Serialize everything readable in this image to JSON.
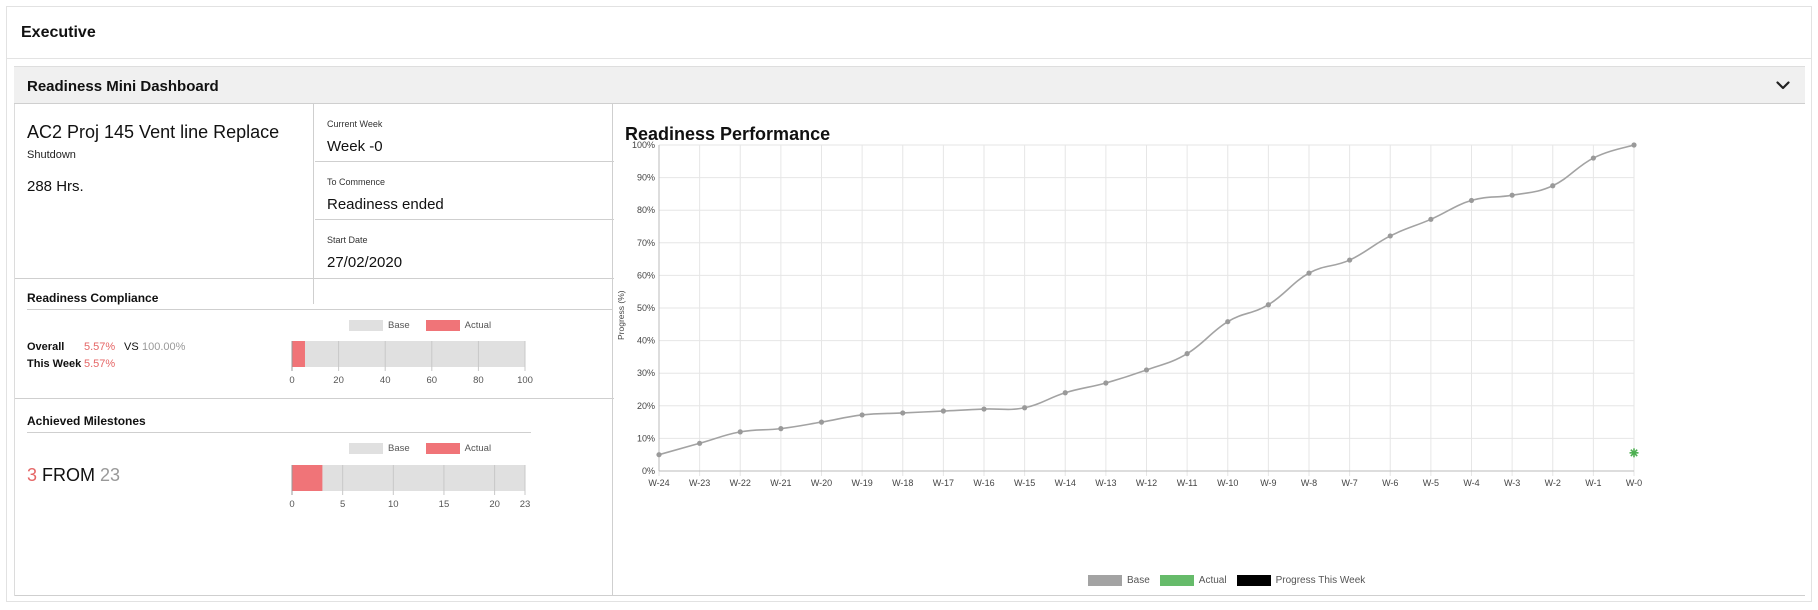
{
  "page": {
    "section_title": "Executive",
    "panel_title": "Readiness Mini Dashboard",
    "collapse_icon": "chevron-down-icon"
  },
  "project": {
    "name": "AC2 Proj 145 Vent line Replace",
    "type": "Shutdown",
    "hours": "288 Hrs."
  },
  "info": {
    "current_week_label": "Current Week",
    "current_week_value": "Week -0",
    "to_commence_label": "To Commence",
    "to_commence_value": "Readiness ended",
    "start_date_label": "Start Date",
    "start_date_value": "27/02/2020"
  },
  "compliance": {
    "title": "Readiness Compliance",
    "legend_base": "Base",
    "legend_actual": "Actual",
    "overall_label": "Overall",
    "overall_actual": "5.57%",
    "vs": "VS",
    "overall_base": "100.00%",
    "this_week_label": "This Week",
    "this_week_value": "5.57%",
    "bar": {
      "base": 100,
      "actual": 5.57,
      "max": 100,
      "ticks": [
        0,
        20,
        40,
        60,
        80,
        100
      ]
    }
  },
  "milestones": {
    "title": "Achieved Milestones",
    "legend_base": "Base",
    "legend_actual": "Actual",
    "achieved": "3",
    "from": "FROM",
    "total": "23",
    "bar": {
      "base": 23,
      "actual": 3,
      "max": 23,
      "ticks": [
        0,
        5,
        10,
        15,
        20,
        23
      ]
    }
  },
  "colors": {
    "base_bar": "#e0e0e0",
    "actual_bar": "#f07478",
    "line": "#a3a3a3",
    "actual_marker": "#4caf50",
    "progress_this_week": "#000000",
    "legend_base": "#a3a3a3",
    "legend_actual": "#66bb6a"
  },
  "chart_data": {
    "type": "line",
    "title": "Readiness Performance",
    "ylabel": "Progress (%)",
    "xlabel": "",
    "categories": [
      "W-24",
      "W-23",
      "W-22",
      "W-21",
      "W-20",
      "W-19",
      "W-18",
      "W-17",
      "W-16",
      "W-15",
      "W-14",
      "W-13",
      "W-12",
      "W-11",
      "W-10",
      "W-9",
      "W-8",
      "W-7",
      "W-6",
      "W-5",
      "W-4",
      "W-3",
      "W-2",
      "W-1",
      "W-0"
    ],
    "ylim": [
      0,
      100
    ],
    "yticks": [
      0,
      10,
      20,
      30,
      40,
      50,
      60,
      70,
      80,
      90,
      100
    ],
    "ytick_labels": [
      "0%",
      "10%",
      "20%",
      "30%",
      "40%",
      "50%",
      "60%",
      "70%",
      "80%",
      "90%",
      "100%"
    ],
    "grid": true,
    "legend_position": "bottom",
    "series": [
      {
        "name": "Base",
        "values": [
          5,
          8.5,
          12,
          13,
          15,
          17.2,
          17.8,
          18.4,
          19,
          19.4,
          24,
          27,
          31,
          36,
          45.8,
          51,
          60.7,
          64.7,
          72.1,
          77.2,
          83,
          84.6,
          87.5,
          96,
          100
        ]
      },
      {
        "name": "Actual",
        "values": [
          null,
          null,
          null,
          null,
          null,
          null,
          null,
          null,
          null,
          null,
          null,
          null,
          null,
          null,
          null,
          null,
          null,
          null,
          null,
          null,
          null,
          null,
          null,
          null,
          5.57
        ]
      },
      {
        "name": "Progress This Week",
        "values": []
      }
    ]
  }
}
